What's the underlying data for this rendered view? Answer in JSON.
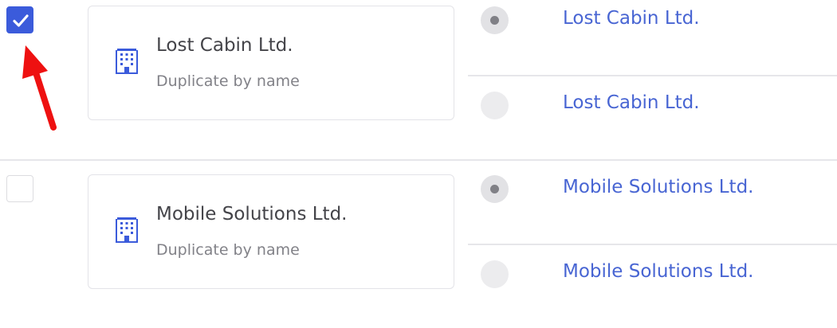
{
  "colors": {
    "accent": "#3b5bdb",
    "link": "#4865d3",
    "annotation_arrow": "#ee1111"
  },
  "groups": [
    {
      "checked": true,
      "icon": "building-icon",
      "card": {
        "title": "Lost Cabin Ltd.",
        "subtitle": "Duplicate by name"
      },
      "options": [
        {
          "label": "Lost Cabin Ltd.",
          "selected": true
        },
        {
          "label": "Lost Cabin Ltd.",
          "selected": false
        }
      ]
    },
    {
      "checked": false,
      "icon": "building-icon",
      "card": {
        "title": "Mobile Solutions Ltd.",
        "subtitle": "Duplicate by name"
      },
      "options": [
        {
          "label": "Mobile Solutions Ltd.",
          "selected": true
        },
        {
          "label": "Mobile Solutions Ltd.",
          "selected": false
        }
      ]
    }
  ]
}
